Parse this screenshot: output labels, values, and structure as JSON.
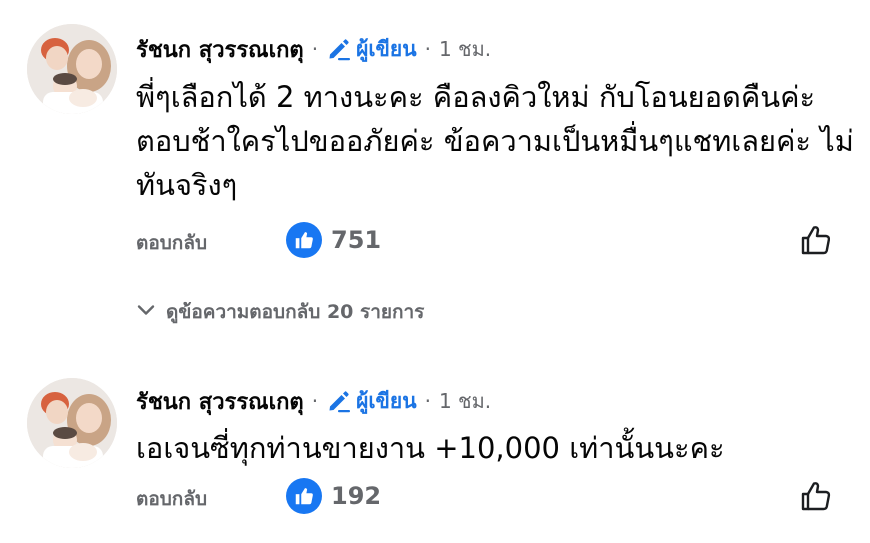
{
  "comments": [
    {
      "author": "รัชนก สุวรรณเกตุ",
      "badge_icon": "pencil-icon",
      "badge_label": "ผู้เขียน",
      "separator": "·",
      "time": "1 ชม.",
      "text": "พี่ๆเลือกได้ 2 ทางนะคะ คือลงคิวใหม่ กับโอนยอดคืนค่ะ ตอบช้าใครไปขออภัยค่ะ ข้อความเป็นหมื่นๆแชทเลยค่ะ ไม่ทันจริงๆ",
      "reply_label": "ตอบกลับ",
      "reaction_icon": "like-icon",
      "reaction_count": "751"
    },
    {
      "author": "รัชนก สุวรรณเกตุ",
      "badge_icon": "pencil-icon",
      "badge_label": "ผู้เขียน",
      "separator": "·",
      "time": "1 ชม.",
      "text": "เอเจนซี่ทุกท่านขายงาน +10,000 เท่านั้นนะคะ",
      "reply_label": "ตอบกลับ",
      "reaction_icon": "like-icon",
      "reaction_count": "192"
    }
  ],
  "view_replies": {
    "icon": "chevron-down-icon",
    "label": "ดูข้อความตอบกลับ 20 รายการ"
  },
  "colors": {
    "accent": "#1877f2",
    "badge": "#1b74e4",
    "secondary_text": "#65676b",
    "primary_text": "#050505"
  }
}
